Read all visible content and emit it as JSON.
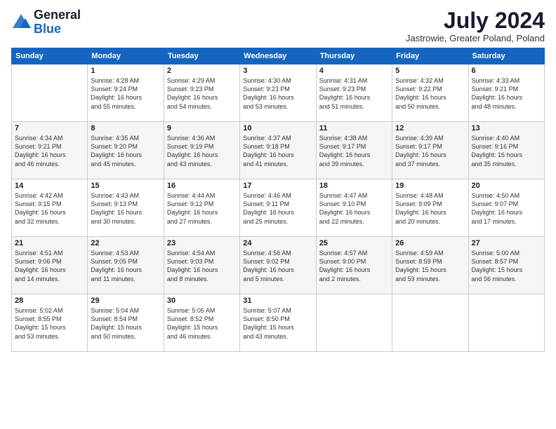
{
  "header": {
    "logo_general": "General",
    "logo_blue": "Blue",
    "month_year": "July 2024",
    "location": "Jastrowie, Greater Poland, Poland"
  },
  "days_of_week": [
    "Sunday",
    "Monday",
    "Tuesday",
    "Wednesday",
    "Thursday",
    "Friday",
    "Saturday"
  ],
  "weeks": [
    [
      {
        "day": "",
        "info": ""
      },
      {
        "day": "1",
        "info": "Sunrise: 4:28 AM\nSunset: 9:24 PM\nDaylight: 16 hours\nand 55 minutes."
      },
      {
        "day": "2",
        "info": "Sunrise: 4:29 AM\nSunset: 9:23 PM\nDaylight: 16 hours\nand 54 minutes."
      },
      {
        "day": "3",
        "info": "Sunrise: 4:30 AM\nSunset: 9:23 PM\nDaylight: 16 hours\nand 53 minutes."
      },
      {
        "day": "4",
        "info": "Sunrise: 4:31 AM\nSunset: 9:23 PM\nDaylight: 16 hours\nand 51 minutes."
      },
      {
        "day": "5",
        "info": "Sunrise: 4:32 AM\nSunset: 9:22 PM\nDaylight: 16 hours\nand 50 minutes."
      },
      {
        "day": "6",
        "info": "Sunrise: 4:33 AM\nSunset: 9:21 PM\nDaylight: 16 hours\nand 48 minutes."
      }
    ],
    [
      {
        "day": "7",
        "info": "Sunrise: 4:34 AM\nSunset: 9:21 PM\nDaylight: 16 hours\nand 46 minutes."
      },
      {
        "day": "8",
        "info": "Sunrise: 4:35 AM\nSunset: 9:20 PM\nDaylight: 16 hours\nand 45 minutes."
      },
      {
        "day": "9",
        "info": "Sunrise: 4:36 AM\nSunset: 9:19 PM\nDaylight: 16 hours\nand 43 minutes."
      },
      {
        "day": "10",
        "info": "Sunrise: 4:37 AM\nSunset: 9:18 PM\nDaylight: 16 hours\nand 41 minutes."
      },
      {
        "day": "11",
        "info": "Sunrise: 4:38 AM\nSunset: 9:17 PM\nDaylight: 16 hours\nand 39 minutes."
      },
      {
        "day": "12",
        "info": "Sunrise: 4:39 AM\nSunset: 9:17 PM\nDaylight: 16 hours\nand 37 minutes."
      },
      {
        "day": "13",
        "info": "Sunrise: 4:40 AM\nSunset: 9:16 PM\nDaylight: 16 hours\nand 35 minutes."
      }
    ],
    [
      {
        "day": "14",
        "info": "Sunrise: 4:42 AM\nSunset: 9:15 PM\nDaylight: 16 hours\nand 32 minutes."
      },
      {
        "day": "15",
        "info": "Sunrise: 4:43 AM\nSunset: 9:13 PM\nDaylight: 16 hours\nand 30 minutes."
      },
      {
        "day": "16",
        "info": "Sunrise: 4:44 AM\nSunset: 9:12 PM\nDaylight: 16 hours\nand 27 minutes."
      },
      {
        "day": "17",
        "info": "Sunrise: 4:46 AM\nSunset: 9:11 PM\nDaylight: 16 hours\nand 25 minutes."
      },
      {
        "day": "18",
        "info": "Sunrise: 4:47 AM\nSunset: 9:10 PM\nDaylight: 16 hours\nand 22 minutes."
      },
      {
        "day": "19",
        "info": "Sunrise: 4:48 AM\nSunset: 9:09 PM\nDaylight: 16 hours\nand 20 minutes."
      },
      {
        "day": "20",
        "info": "Sunrise: 4:50 AM\nSunset: 9:07 PM\nDaylight: 16 hours\nand 17 minutes."
      }
    ],
    [
      {
        "day": "21",
        "info": "Sunrise: 4:51 AM\nSunset: 9:06 PM\nDaylight: 16 hours\nand 14 minutes."
      },
      {
        "day": "22",
        "info": "Sunrise: 4:53 AM\nSunset: 9:05 PM\nDaylight: 16 hours\nand 11 minutes."
      },
      {
        "day": "23",
        "info": "Sunrise: 4:54 AM\nSunset: 9:03 PM\nDaylight: 16 hours\nand 8 minutes."
      },
      {
        "day": "24",
        "info": "Sunrise: 4:56 AM\nSunset: 9:02 PM\nDaylight: 16 hours\nand 5 minutes."
      },
      {
        "day": "25",
        "info": "Sunrise: 4:57 AM\nSunset: 9:00 PM\nDaylight: 16 hours\nand 2 minutes."
      },
      {
        "day": "26",
        "info": "Sunrise: 4:59 AM\nSunset: 8:59 PM\nDaylight: 15 hours\nand 59 minutes."
      },
      {
        "day": "27",
        "info": "Sunrise: 5:00 AM\nSunset: 8:57 PM\nDaylight: 15 hours\nand 56 minutes."
      }
    ],
    [
      {
        "day": "28",
        "info": "Sunrise: 5:02 AM\nSunset: 8:55 PM\nDaylight: 15 hours\nand 53 minutes."
      },
      {
        "day": "29",
        "info": "Sunrise: 5:04 AM\nSunset: 8:54 PM\nDaylight: 15 hours\nand 50 minutes."
      },
      {
        "day": "30",
        "info": "Sunrise: 5:05 AM\nSunset: 8:52 PM\nDaylight: 15 hours\nand 46 minutes."
      },
      {
        "day": "31",
        "info": "Sunrise: 5:07 AM\nSunset: 8:50 PM\nDaylight: 15 hours\nand 43 minutes."
      },
      {
        "day": "",
        "info": ""
      },
      {
        "day": "",
        "info": ""
      },
      {
        "day": "",
        "info": ""
      }
    ]
  ]
}
